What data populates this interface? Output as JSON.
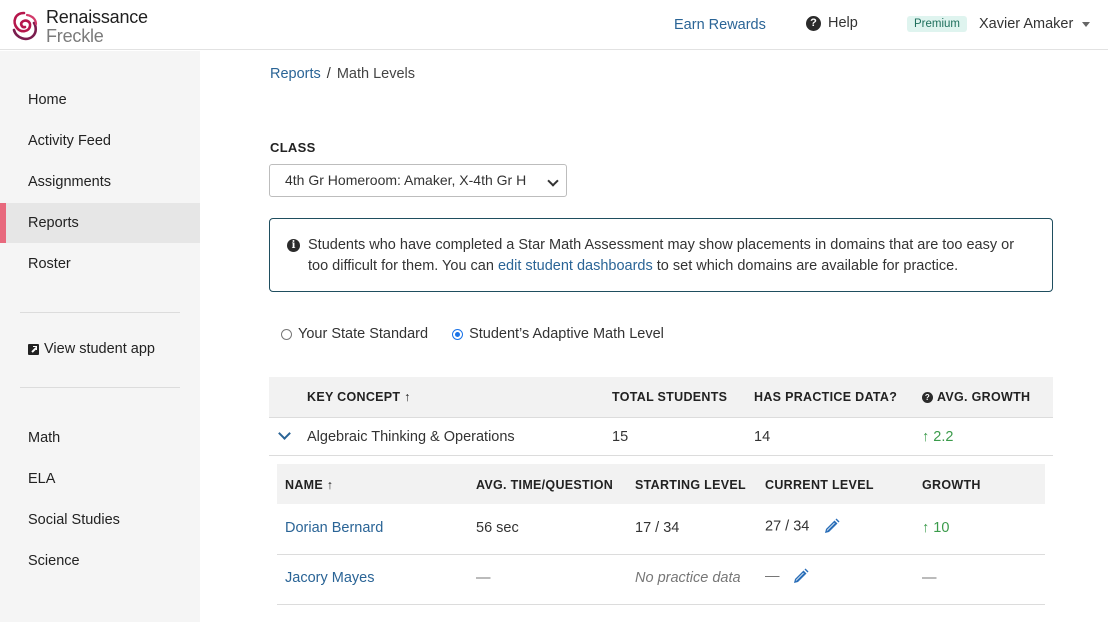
{
  "header": {
    "logo_line1": "Renaissance",
    "logo_line2": "Freckle",
    "earn_rewards": "Earn Rewards",
    "help": "Help",
    "premium_badge": "Premium",
    "user_name": "Xavier Amaker"
  },
  "sidebar": {
    "items": [
      {
        "label": "Home"
      },
      {
        "label": "Activity Feed"
      },
      {
        "label": "Assignments"
      },
      {
        "label": "Reports"
      },
      {
        "label": "Roster"
      }
    ],
    "view_student_app": "View student app",
    "subjects": [
      {
        "label": "Math"
      },
      {
        "label": "ELA"
      },
      {
        "label": "Social Studies"
      },
      {
        "label": "Science"
      }
    ]
  },
  "breadcrumb": {
    "parent": "Reports",
    "separator": "/",
    "current": "Math Levels"
  },
  "class_filter": {
    "label": "CLASS",
    "selected": "4th Gr Homeroom: Amaker, X-4th Gr H"
  },
  "info": {
    "text_before": "Students who have completed a Star Math Assessment may show placements in domains that are too easy or too difficult for them. You can ",
    "link": "edit student dashboards",
    "text_after": " to set which domains are available for practice."
  },
  "mode": {
    "option1": "Your State Standard",
    "option2": "Student’s Adaptive Math Level",
    "selected": "option2"
  },
  "table": {
    "headers": {
      "key_concept": "KEY CONCEPT",
      "total_students": "TOTAL STUDENTS",
      "has_practice": "HAS PRACTICE DATA?",
      "avg_growth": "AVG. GROWTH"
    },
    "rows": [
      {
        "concept": "Algebraic Thinking & Operations",
        "total_students": "15",
        "has_practice": "14",
        "avg_growth": "2.2"
      }
    ]
  },
  "students": {
    "headers": {
      "name": "NAME",
      "avg_time": "AVG. TIME/QUESTION",
      "starting_level": "STARTING LEVEL",
      "current_level": "CURRENT LEVEL",
      "growth": "GROWTH"
    },
    "rows": [
      {
        "name": "Dorian Bernard",
        "avg_time": "56 sec",
        "starting_level": "17 / 34",
        "current_level": "27 / 34",
        "growth": "10"
      },
      {
        "name": "Jacory Mayes",
        "avg_time": "—",
        "starting_level": "No practice data",
        "current_level": "—",
        "growth": "—"
      }
    ]
  },
  "colors": {
    "accent": "#2a6496",
    "active_marker": "#e8697d",
    "growth_green": "#3b9b4b",
    "info_border": "#1f4e5f"
  },
  "icons": {
    "sort": "sort-up-icon",
    "help": "question-circle-icon",
    "info": "info-circle-icon",
    "edit": "pencil-icon",
    "expand": "chevron-down-icon",
    "growth": "arrow-up-icon"
  }
}
